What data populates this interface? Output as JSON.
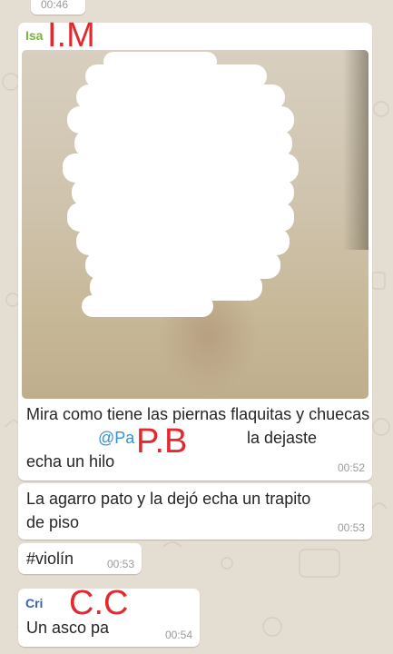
{
  "colors": {
    "wallpaper": "#e4ddd2",
    "bubble": "#ffffff",
    "time": "#9a9a9a",
    "label_red": "#e4282f",
    "mention": "#3b8fd9",
    "sender_green": "#7bb33f",
    "sender_blue": "#3c5fae"
  },
  "top_timestamp": "00:46",
  "messages": [
    {
      "sender": "Isa",
      "overlay_label": "I.M",
      "has_photo": true,
      "text_before_mention": "Mira como tiene las piernas flaquitas y chuecas",
      "mention": "@Pa",
      "overlay_label_2": "P.B",
      "text_after_mention": "la dejaste",
      "text_line3": "echa un hilo",
      "time": "00:52"
    },
    {
      "text_line1": "La agarro pato y la dejó echa un trapito",
      "text_line2": "de piso",
      "time": "00:53"
    },
    {
      "text": "#violín",
      "time": "00:53"
    },
    {
      "sender": "Cri",
      "overlay_label": "C.C",
      "text": "Un asco pa",
      "time": "00:54"
    }
  ]
}
